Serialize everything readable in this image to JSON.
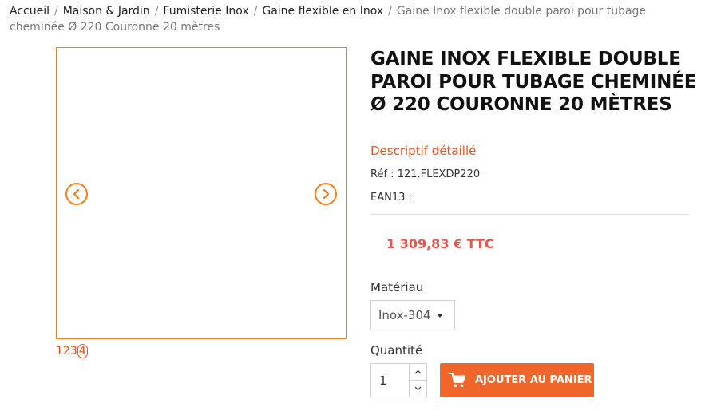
{
  "breadcrumb": {
    "items": [
      "Accueil",
      "Maison & Jardin",
      "Fumisterie Inox",
      "Gaine flexible en Inox"
    ],
    "current": "Gaine Inox flexible double paroi pour tubage cheminée Ø 220 Couronne 20 mètres",
    "separator": "/"
  },
  "gallery": {
    "prev_icon": "chevron-left-icon",
    "next_icon": "chevron-right-icon",
    "pager": [
      "1",
      "2",
      "3",
      "4"
    ],
    "active_page": "4"
  },
  "product": {
    "title": "GAINE INOX FLEXIBLE DOUBLE PAROI POUR TUBAGE CHEMINÉE Ø 220 COURONNE 20 MÈTRES",
    "description_link": "Descriptif détaillé",
    "ref": "Réf : 121.FLEXDP220",
    "ean": "EAN13 :",
    "price": "1 309,83 € TTC"
  },
  "options": {
    "material_label": "Matériau",
    "material_value": "Inox-304",
    "quantity_label": "Quantité",
    "quantity_value": "1"
  },
  "cart": {
    "button_label": "AJOUTER AU PANIER",
    "icon": "cart-icon"
  },
  "colors": {
    "accent": "#f0662a",
    "price": "#e8554e",
    "gallery_border": "#f07f1d"
  }
}
